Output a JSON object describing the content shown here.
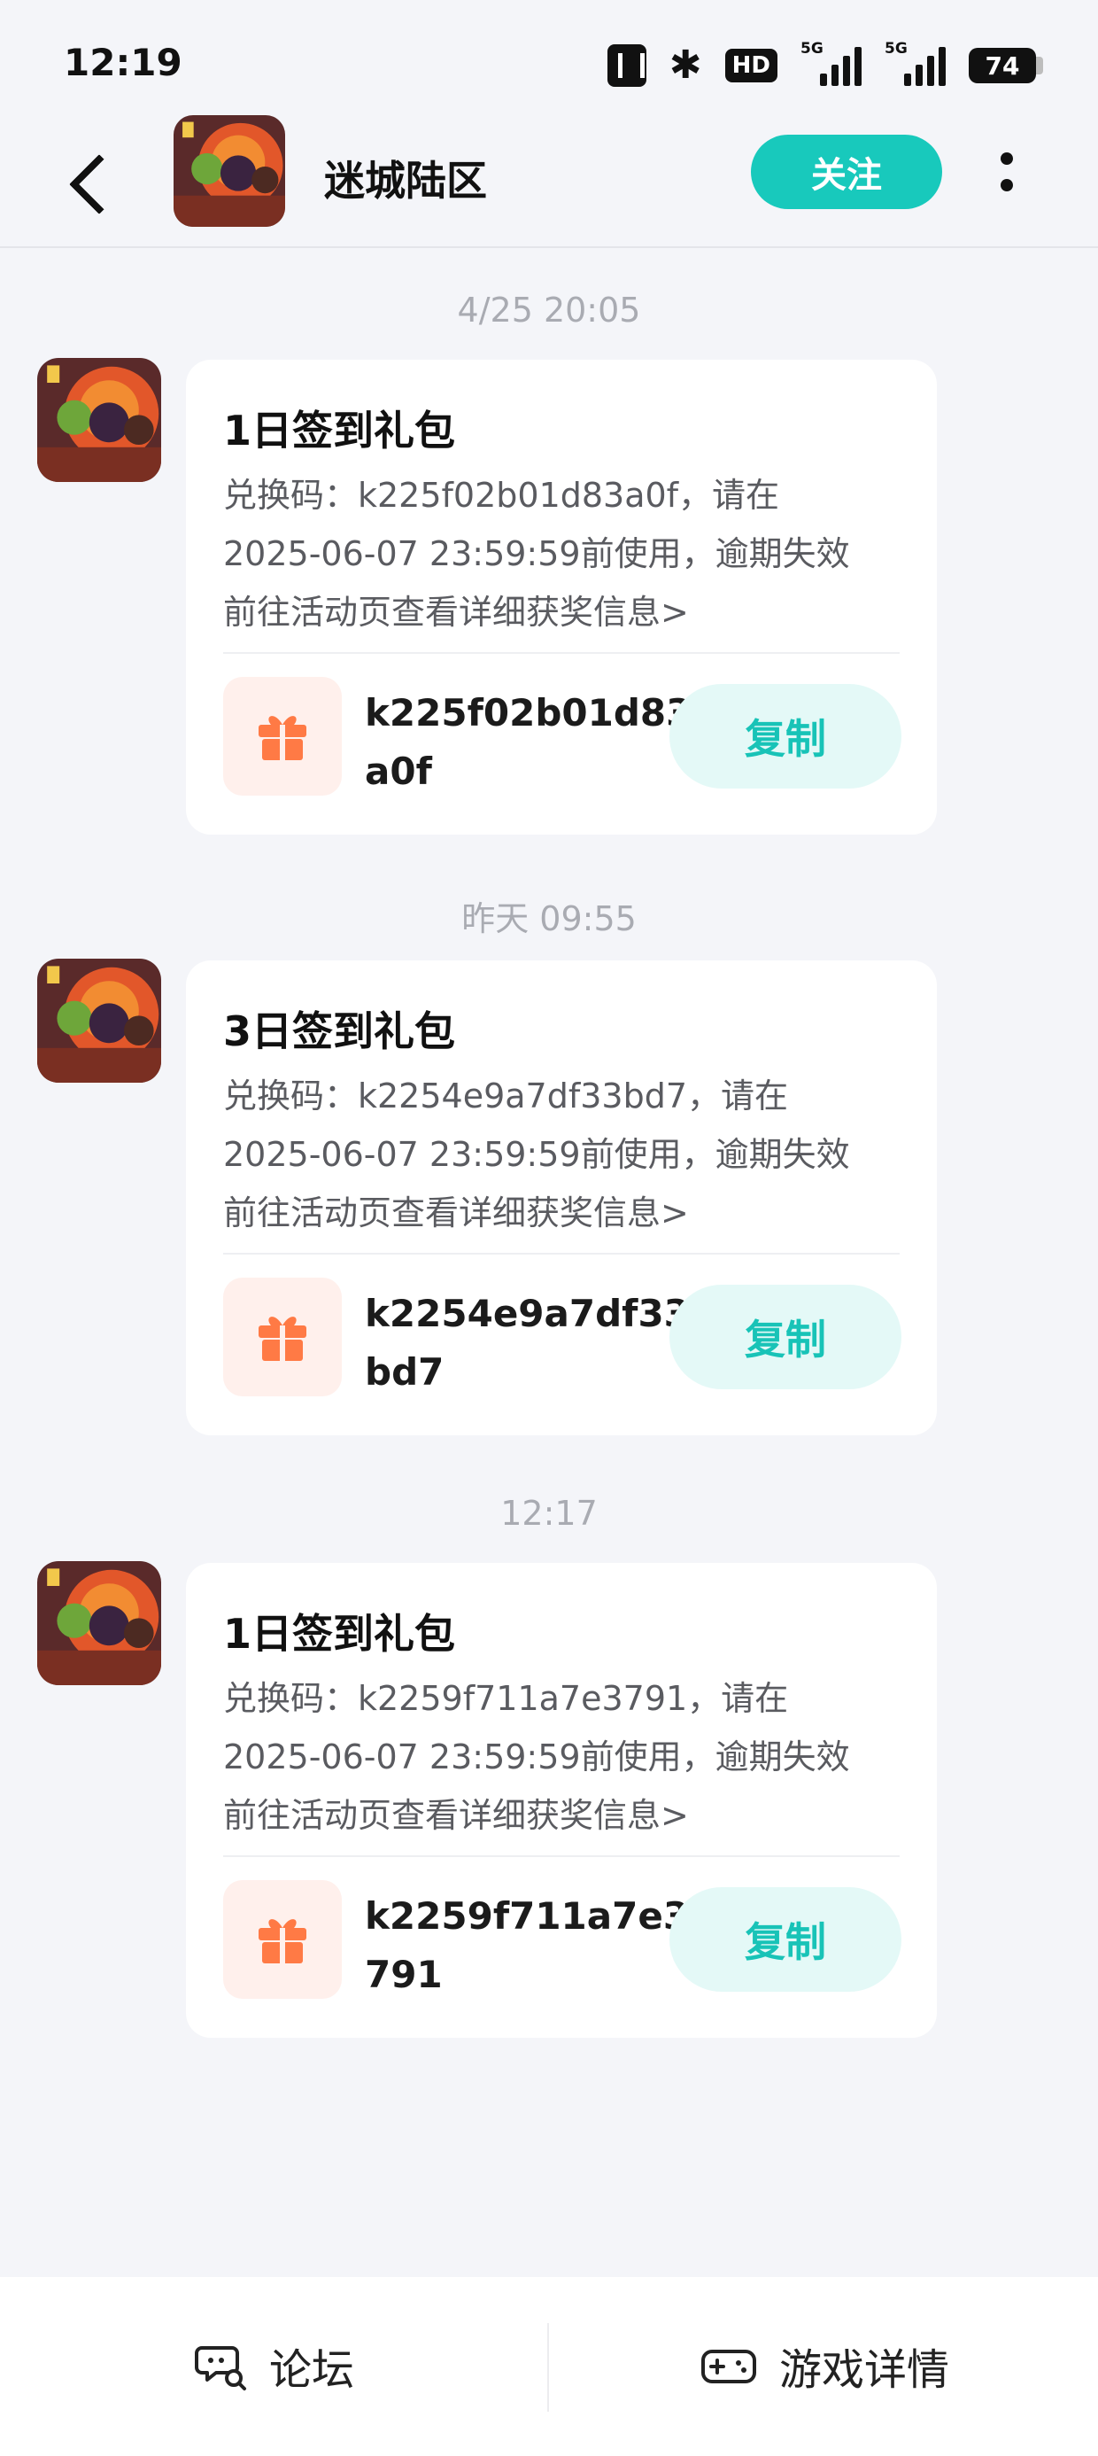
{
  "status_bar": {
    "time": "12:19",
    "icons": [
      "nfc-icon",
      "bluetooth-icon",
      "hd-icon",
      "signal-5g-icon",
      "signal-5g-icon"
    ],
    "network_label": "5G",
    "battery": "74"
  },
  "header": {
    "title": "迷城陆区",
    "follow_label": "关注"
  },
  "messages": [
    {
      "timestamp": "4/25  20:05",
      "title": "1日签到礼包",
      "line1": "兑换码：k225f02b01d83a0f，请在",
      "line2": "2025-06-07 23:59:59前使用，逾期失效",
      "line3": "前往活动页查看详细获奖信息>",
      "code_line1": "k225f02b01d83",
      "code_line2": "a0f",
      "copy_label": "复制"
    },
    {
      "timestamp": "昨天  09:55",
      "title": "3日签到礼包",
      "line1": "兑换码：k2254e9a7df33bd7，请在",
      "line2": "2025-06-07 23:59:59前使用，逾期失效",
      "line3": "前往活动页查看详细获奖信息>",
      "code_line1": "k2254e9a7df33",
      "code_line2": "bd7",
      "copy_label": "复制"
    },
    {
      "timestamp": "12:17",
      "title": "1日签到礼包",
      "line1": "兑换码：k2259f711a7e3791，请在",
      "line2": "2025-06-07 23:59:59前使用，逾期失效",
      "line3": "前往活动页查看详细获奖信息>",
      "code_line1": "k2259f711a7e3",
      "code_line2": "791",
      "copy_label": "复制"
    }
  ],
  "bottom_bar": {
    "forum_label": "论坛",
    "game_details_label": "游戏详情"
  },
  "colors": {
    "accent": "#18c9bc",
    "copy_bg": "#e4f9f7",
    "gift": "#ff7a45",
    "background": "#f4f5f9"
  }
}
